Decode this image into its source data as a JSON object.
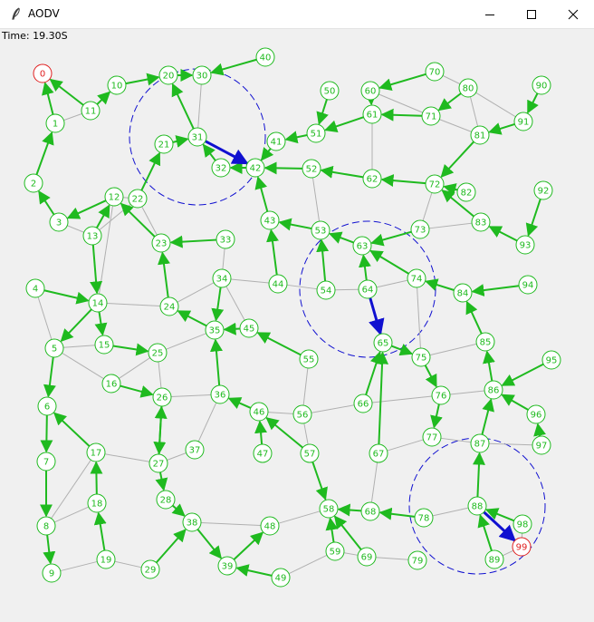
{
  "window": {
    "title": "AODV",
    "minimize": "minimize",
    "maximize": "maximize",
    "close": "close"
  },
  "status": {
    "time": "Time: 19.30S"
  },
  "colors": {
    "node": "#1fba1f",
    "endpoint": "#e02020",
    "route_arrow": "#1fba1f",
    "active_arrow": "#1010d0",
    "range_circle": "#1010d0",
    "link": "#b0b0b0"
  },
  "icons": {
    "app": "feather-icon"
  },
  "network": {
    "endpoints": [
      "0",
      "99"
    ],
    "nodes": [
      "0",
      "1",
      "2",
      "3",
      "4",
      "5",
      "6",
      "7",
      "8",
      "9",
      "10",
      "11",
      "12",
      "13",
      "14",
      "15",
      "16",
      "17",
      "18",
      "19",
      "20",
      "21",
      "22",
      "23",
      "24",
      "25",
      "26",
      "27",
      "28",
      "29",
      "30",
      "31",
      "32",
      "33",
      "34",
      "35",
      "36",
      "37",
      "38",
      "39",
      "40",
      "41",
      "42",
      "43",
      "44",
      "45",
      "46",
      "47",
      "48",
      "49",
      "50",
      "51",
      "52",
      "53",
      "54",
      "55",
      "56",
      "57",
      "58",
      "59",
      "60",
      "61",
      "62",
      "63",
      "64",
      "65",
      "66",
      "67",
      "68",
      "69",
      "70",
      "71",
      "72",
      "73",
      "74",
      "75",
      "76",
      "77",
      "78",
      "79",
      "80",
      "81",
      "82",
      "83",
      "84",
      "85",
      "86",
      "87",
      "88",
      "89",
      "90",
      "91",
      "92",
      "93",
      "94",
      "95",
      "96",
      "97",
      "98",
      "99"
    ],
    "links": [
      [
        "0",
        "11"
      ],
      [
        "1",
        "11"
      ],
      [
        "2",
        "3"
      ],
      [
        "3",
        "12"
      ],
      [
        "3",
        "13"
      ],
      [
        "12",
        "22"
      ],
      [
        "13",
        "22"
      ],
      [
        "4",
        "5"
      ],
      [
        "5",
        "15"
      ],
      [
        "5",
        "16"
      ],
      [
        "15",
        "25"
      ],
      [
        "16",
        "25"
      ],
      [
        "24",
        "34"
      ],
      [
        "25",
        "35"
      ],
      [
        "25",
        "26"
      ],
      [
        "26",
        "36"
      ],
      [
        "27",
        "37"
      ],
      [
        "36",
        "37"
      ],
      [
        "34",
        "44"
      ],
      [
        "34",
        "45"
      ],
      [
        "35",
        "45"
      ],
      [
        "44",
        "54"
      ],
      [
        "45",
        "55"
      ],
      [
        "55",
        "56"
      ],
      [
        "56",
        "66"
      ],
      [
        "57",
        "58"
      ],
      [
        "58",
        "68"
      ],
      [
        "59",
        "69"
      ],
      [
        "67",
        "68"
      ],
      [
        "67",
        "77"
      ],
      [
        "68",
        "78"
      ],
      [
        "69",
        "79"
      ],
      [
        "73",
        "83"
      ],
      [
        "62",
        "72"
      ],
      [
        "72",
        "73"
      ],
      [
        "71",
        "81"
      ],
      [
        "60",
        "70"
      ],
      [
        "60",
        "71"
      ],
      [
        "70",
        "80"
      ],
      [
        "80",
        "91"
      ],
      [
        "80",
        "81"
      ],
      [
        "81",
        "91"
      ],
      [
        "82",
        "72"
      ],
      [
        "83",
        "93"
      ],
      [
        "84",
        "85"
      ],
      [
        "85",
        "75"
      ],
      [
        "76",
        "86"
      ],
      [
        "77",
        "87"
      ],
      [
        "86",
        "87"
      ],
      [
        "87",
        "97"
      ],
      [
        "88",
        "89"
      ],
      [
        "88",
        "78"
      ],
      [
        "98",
        "99"
      ],
      [
        "89",
        "99"
      ],
      [
        "54",
        "64"
      ],
      [
        "53",
        "54"
      ],
      [
        "52",
        "53"
      ],
      [
        "42",
        "52"
      ],
      [
        "42",
        "32"
      ],
      [
        "21",
        "31"
      ],
      [
        "31",
        "30"
      ],
      [
        "21",
        "22"
      ],
      [
        "22",
        "23"
      ],
      [
        "12",
        "14"
      ],
      [
        "17",
        "27"
      ],
      [
        "17",
        "18"
      ],
      [
        "8",
        "17"
      ],
      [
        "8",
        "18"
      ],
      [
        "9",
        "19"
      ],
      [
        "19",
        "29"
      ],
      [
        "39",
        "48"
      ],
      [
        "48",
        "58"
      ],
      [
        "49",
        "59"
      ],
      [
        "38",
        "39"
      ],
      [
        "38",
        "48"
      ],
      [
        "43",
        "53"
      ],
      [
        "52",
        "62"
      ],
      [
        "61",
        "62"
      ],
      [
        "63",
        "73"
      ],
      [
        "64",
        "74"
      ],
      [
        "74",
        "75"
      ],
      [
        "65",
        "66"
      ],
      [
        "41",
        "42"
      ],
      [
        "32",
        "31"
      ],
      [
        "33",
        "34"
      ],
      [
        "23",
        "24"
      ],
      [
        "26",
        "27"
      ],
      [
        "14",
        "24"
      ],
      [
        "46",
        "56"
      ],
      [
        "46",
        "36"
      ],
      [
        "57",
        "56"
      ],
      [
        "66",
        "76"
      ],
      [
        "84",
        "74"
      ]
    ],
    "route_arrows": [
      [
        "1",
        "0"
      ],
      [
        "11",
        "0"
      ],
      [
        "11",
        "10"
      ],
      [
        "10",
        "20"
      ],
      [
        "20",
        "30"
      ],
      [
        "40",
        "30"
      ],
      [
        "31",
        "20"
      ],
      [
        "2",
        "1"
      ],
      [
        "3",
        "2"
      ],
      [
        "12",
        "3"
      ],
      [
        "13",
        "14"
      ],
      [
        "14",
        "5"
      ],
      [
        "5",
        "6"
      ],
      [
        "6",
        "7"
      ],
      [
        "7",
        "8"
      ],
      [
        "8",
        "9"
      ],
      [
        "9",
        "9"
      ],
      [
        "4",
        "14"
      ],
      [
        "14",
        "15"
      ],
      [
        "15",
        "25"
      ],
      [
        "16",
        "26"
      ],
      [
        "17",
        "6"
      ],
      [
        "18",
        "17"
      ],
      [
        "19",
        "18"
      ],
      [
        "29",
        "38"
      ],
      [
        "38",
        "39"
      ],
      [
        "39",
        "48"
      ],
      [
        "49",
        "39"
      ],
      [
        "26",
        "27"
      ],
      [
        "27",
        "28"
      ],
      [
        "28",
        "38"
      ],
      [
        "27",
        "26"
      ],
      [
        "24",
        "23"
      ],
      [
        "35",
        "24"
      ],
      [
        "36",
        "35"
      ],
      [
        "34",
        "35"
      ],
      [
        "45",
        "35"
      ],
      [
        "55",
        "45"
      ],
      [
        "44",
        "43"
      ],
      [
        "43",
        "42"
      ],
      [
        "46",
        "36"
      ],
      [
        "47",
        "46"
      ],
      [
        "57",
        "46"
      ],
      [
        "57",
        "58"
      ],
      [
        "59",
        "58"
      ],
      [
        "69",
        "58"
      ],
      [
        "68",
        "58"
      ],
      [
        "78",
        "68"
      ],
      [
        "67",
        "65"
      ],
      [
        "66",
        "65"
      ],
      [
        "65",
        "75"
      ],
      [
        "75",
        "76"
      ],
      [
        "76",
        "77"
      ],
      [
        "87",
        "86"
      ],
      [
        "88",
        "87"
      ],
      [
        "89",
        "88"
      ],
      [
        "98",
        "88"
      ],
      [
        "96",
        "86"
      ],
      [
        "95",
        "86"
      ],
      [
        "97",
        "96"
      ],
      [
        "86",
        "85"
      ],
      [
        "85",
        "84"
      ],
      [
        "94",
        "84"
      ],
      [
        "92",
        "93"
      ],
      [
        "93",
        "83"
      ],
      [
        "83",
        "72"
      ],
      [
        "82",
        "72"
      ],
      [
        "81",
        "72"
      ],
      [
        "90",
        "91"
      ],
      [
        "91",
        "81"
      ],
      [
        "80",
        "71"
      ],
      [
        "70",
        "60"
      ],
      [
        "71",
        "61"
      ],
      [
        "61",
        "51"
      ],
      [
        "60",
        "61"
      ],
      [
        "50",
        "51"
      ],
      [
        "51",
        "41"
      ],
      [
        "41",
        "42"
      ],
      [
        "52",
        "42"
      ],
      [
        "62",
        "52"
      ],
      [
        "72",
        "62"
      ],
      [
        "73",
        "63"
      ],
      [
        "63",
        "53"
      ],
      [
        "53",
        "43"
      ],
      [
        "54",
        "53"
      ],
      [
        "74",
        "63"
      ],
      [
        "84",
        "74"
      ],
      [
        "64",
        "63"
      ],
      [
        "33",
        "23"
      ],
      [
        "23",
        "12"
      ],
      [
        "13",
        "12"
      ],
      [
        "22",
        "21"
      ],
      [
        "42",
        "32"
      ],
      [
        "32",
        "31"
      ],
      [
        "21",
        "31"
      ]
    ],
    "active_arrows": [
      [
        "31",
        "42"
      ],
      [
        "64",
        "65"
      ],
      [
        "88",
        "99"
      ]
    ],
    "range_circles": [
      "31",
      "64",
      "88"
    ]
  }
}
